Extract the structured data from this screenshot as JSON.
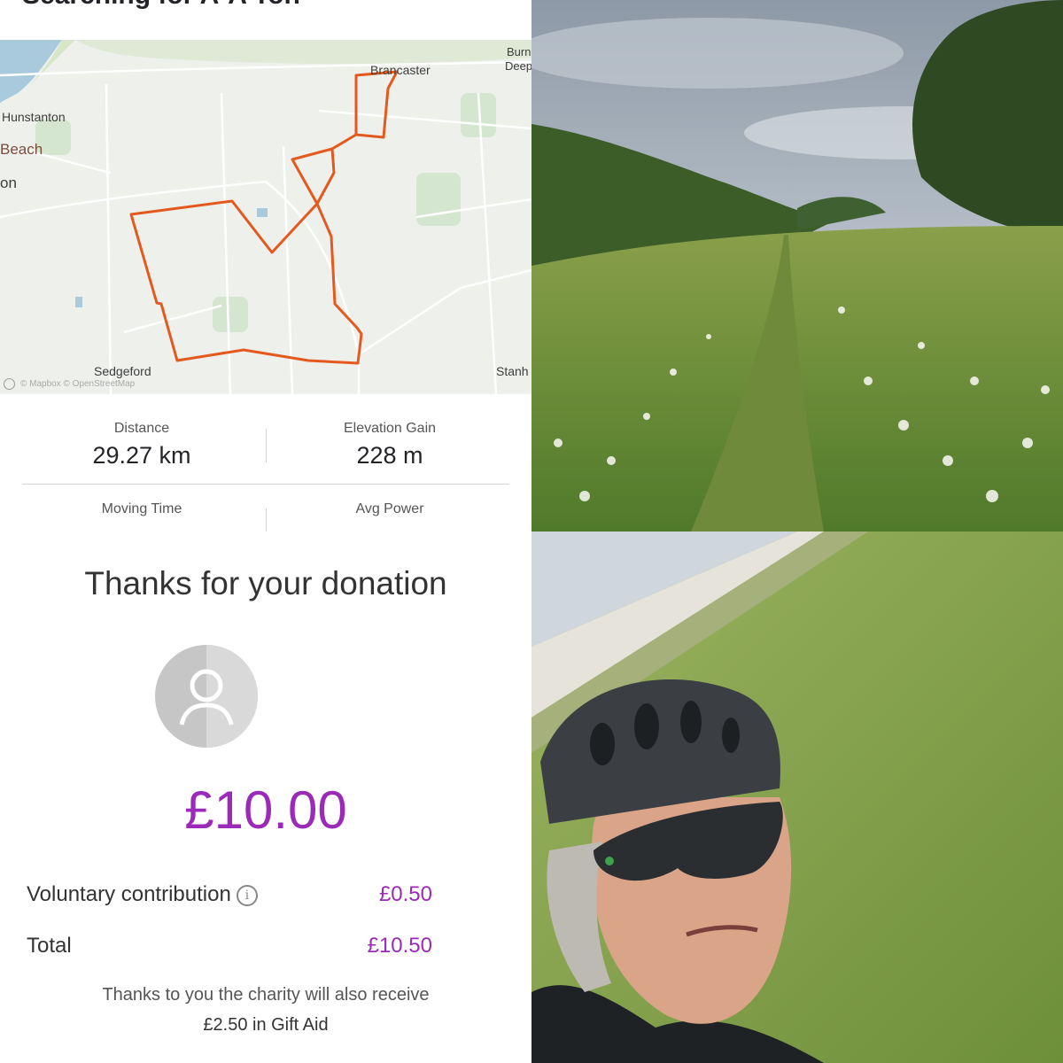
{
  "activity": {
    "title": "Searching for A-A Ton"
  },
  "map": {
    "labels": {
      "brancaster": "Brancaster",
      "burnham_deepdale_line1": "Burn",
      "burnham_deepdale_line2": "Deep",
      "hunstanton": "Hunstanton",
      "beach": "Beach",
      "on": "on",
      "sedgeford": "Sedgeford",
      "stanhoe": "Stanh"
    },
    "attribution": "© Mapbox © OpenStreetMap",
    "route_color": "#e4591d",
    "sea_color": "#a9c9dc"
  },
  "stats": [
    {
      "label": "Distance",
      "value": "29.27 km"
    },
    {
      "label": "Elevation Gain",
      "value": "228 m"
    },
    {
      "label": "Moving Time",
      "value": ""
    },
    {
      "label": "Avg Power",
      "value": ""
    }
  ],
  "donation": {
    "heading": "Thanks for your donation",
    "amount": "£10.00",
    "voluntary_label": "Voluntary contribution",
    "voluntary_value": "£0.50",
    "info_icon": "i",
    "total_label": "Total",
    "total_value": "£10.50",
    "gift_aid_line1": "Thanks to you the charity will also receive",
    "gift_aid_line2": "£2.50 in Gift Aid",
    "accent_color": "#9b2ab8"
  },
  "photos": {
    "countryside": {
      "icon": "landscape-photo"
    },
    "cyclist": {
      "icon": "selfie-photo"
    }
  }
}
